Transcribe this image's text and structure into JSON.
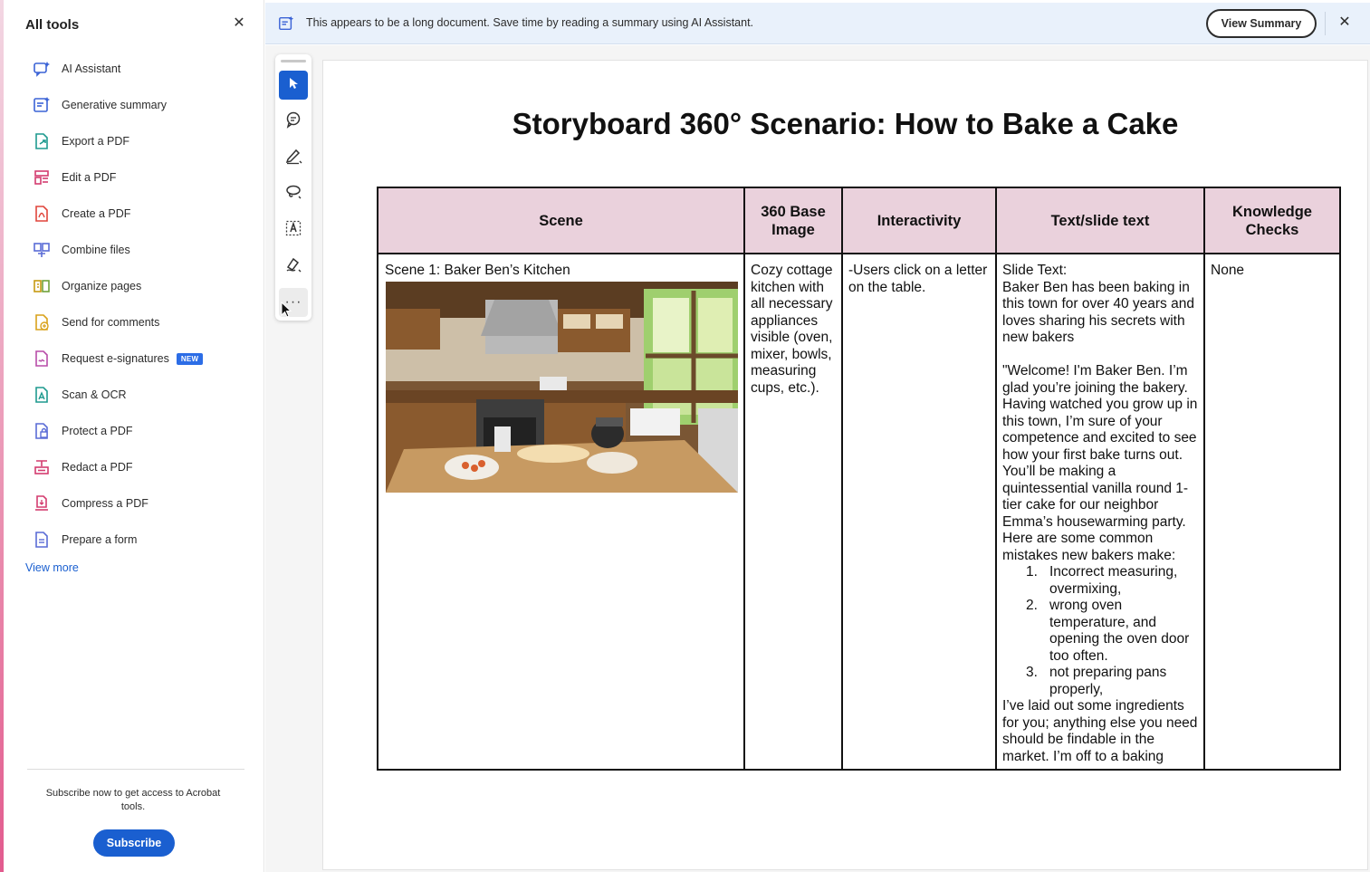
{
  "sidebar": {
    "title": "All tools",
    "close_glyph": "✕",
    "items": [
      {
        "label": "AI Assistant",
        "icon": "ai-assistant-icon"
      },
      {
        "label": "Generative summary",
        "icon": "generative-summary-icon"
      },
      {
        "label": "Export a PDF",
        "icon": "export-pdf-icon"
      },
      {
        "label": "Edit a PDF",
        "icon": "edit-pdf-icon"
      },
      {
        "label": "Create a PDF",
        "icon": "create-pdf-icon"
      },
      {
        "label": "Combine files",
        "icon": "combine-files-icon"
      },
      {
        "label": "Organize pages",
        "icon": "organize-pages-icon"
      },
      {
        "label": "Send for comments",
        "icon": "send-comments-icon"
      },
      {
        "label": "Request e-signatures",
        "icon": "e-signatures-icon",
        "badge": "NEW"
      },
      {
        "label": "Scan & OCR",
        "icon": "scan-ocr-icon"
      },
      {
        "label": "Protect a PDF",
        "icon": "protect-pdf-icon"
      },
      {
        "label": "Redact a PDF",
        "icon": "redact-pdf-icon"
      },
      {
        "label": "Compress a PDF",
        "icon": "compress-pdf-icon"
      },
      {
        "label": "Prepare a form",
        "icon": "prepare-form-icon"
      }
    ],
    "view_more": "View more",
    "subscribe_text": "Subscribe now to get access to Acrobat tools.",
    "subscribe_button": "Subscribe"
  },
  "notice": {
    "text": "This appears to be a long document. Save time by reading a summary using AI Assistant.",
    "button": "View Summary",
    "close_glyph": "✕"
  },
  "palette": {
    "tools": [
      "select-tool",
      "comment-tool",
      "highlight-pen-tool",
      "draw-lasso-tool",
      "text-select-tool",
      "sign-tool",
      "more-tools"
    ],
    "more_glyph": "···"
  },
  "document": {
    "title": "Storyboard 360° Scenario: How to Bake a Cake",
    "headers": [
      "Scene",
      "360 Base Image",
      "Interactivity",
      "Text/slide text",
      "Knowledge Checks"
    ],
    "row": {
      "scene": "Scene 1: Baker Ben’s Kitchen",
      "base_image": "Cozy cottage kitchen with all necessary appliances visible (oven, mixer, bowls, measuring cups, etc.).",
      "interactivity": "-Users click on a letter on the table.",
      "slide_text_head": "Slide Text:",
      "slide_text_p1": "Baker Ben has been baking in this town for over 40 years and loves sharing his secrets with new bakers",
      "slide_text_p2": "\"Welcome! I'm Baker Ben. I’m glad you’re joining the bakery. Having watched you grow up in this town, I’m sure of your competence and excited to see how your first bake turns out. You’ll be making a quintessential vanilla round 1-tier cake for our neighbor Emma’s housewarming party. Here are some common mistakes new bakers make:",
      "mistakes": [
        {
          "num": "1.",
          "text": "Incorrect measuring, overmixing,"
        },
        {
          "num": "2.",
          "text": "wrong oven temperature, and opening the oven door too often."
        },
        {
          "num": "3.",
          "text": "not preparing pans properly,"
        }
      ],
      "slide_text_p3": "I’ve laid out some ingredients for you; anything else you need should be findable in the market. I’m off to a baking",
      "knowledge_checks": "None"
    }
  },
  "colors": {
    "accent": "#1a5fd0",
    "table_header": "#ead1dc",
    "notice_bg": "#e9f1fb"
  }
}
